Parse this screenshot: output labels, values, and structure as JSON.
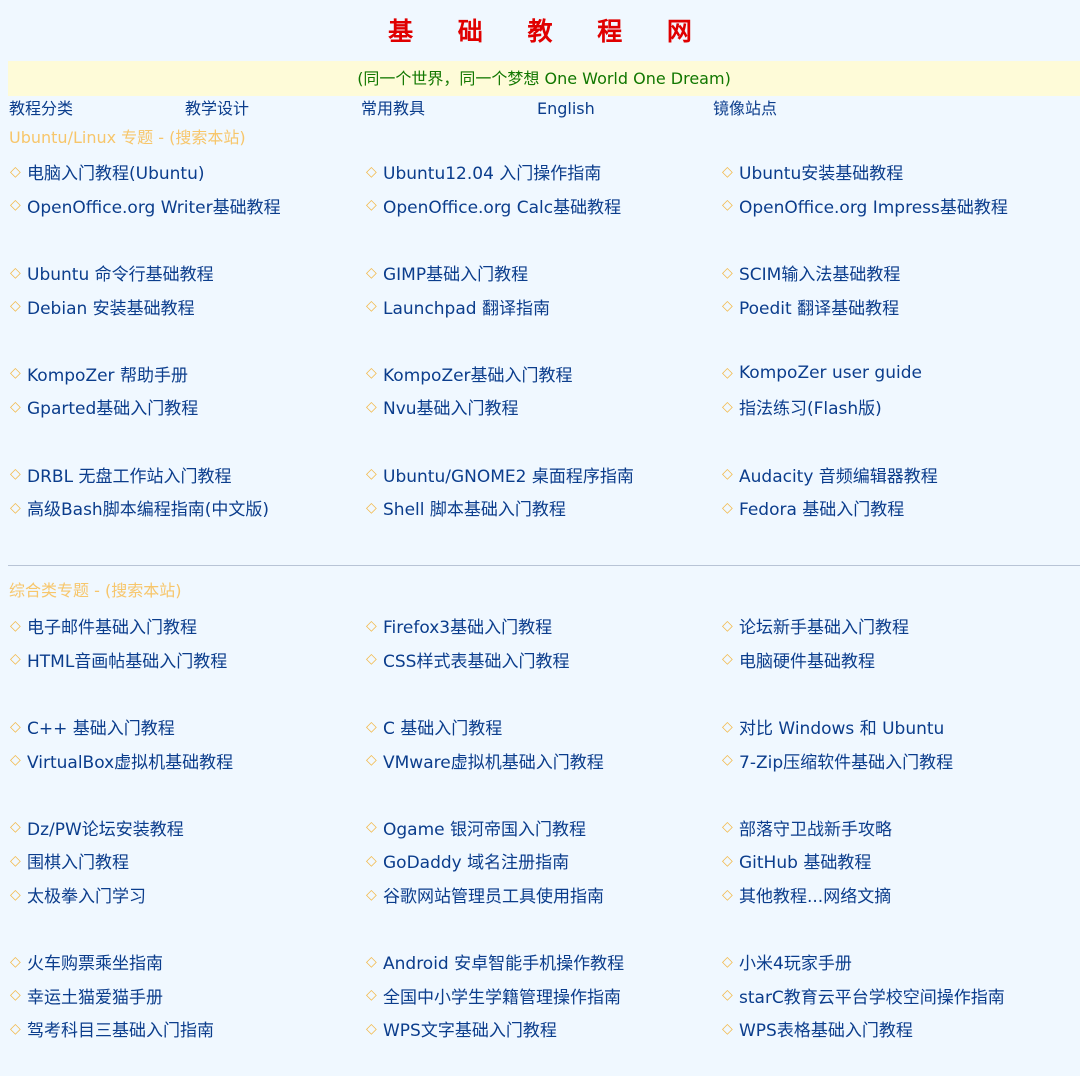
{
  "header": {
    "title": "基 础 教 程 网",
    "slogan": "(同一个世界，同一个梦想 One World One Dream)"
  },
  "nav": [
    "教程分类",
    "教学设计",
    "常用教具",
    "English",
    "镜像站点"
  ],
  "bullet_glyph": "◇",
  "colors": {
    "title": "#e00000",
    "slogan": "#117700",
    "slogan_bg": "#fefbd8",
    "link": "#0b3d8c",
    "section_title": "#f7c66b",
    "bullet": "#f2b94a",
    "page_bg": "#f0f8ff"
  },
  "sections": [
    {
      "title": "Ubuntu/Linux 专题 - (搜索本站)",
      "groups": [
        [
          [
            "电脑入门教程(Ubuntu)",
            "Ubuntu12.04 入门操作指南",
            "Ubuntu安装基础教程"
          ],
          [
            "OpenOffice.org Writer基础教程",
            "OpenOffice.org Calc基础教程",
            "OpenOffice.org Impress基础教程"
          ]
        ],
        [
          [
            "Ubuntu 命令行基础教程",
            "GIMP基础入门教程",
            "SCIM输入法基础教程"
          ],
          [
            "Debian 安装基础教程",
            "Launchpad 翻译指南",
            "Poedit 翻译基础教程"
          ]
        ],
        [
          [
            "KompoZer 帮助手册",
            "KompoZer基础入门教程",
            "KompoZer user guide"
          ],
          [
            "Gparted基础入门教程",
            "Nvu基础入门教程",
            "指法练习(Flash版)"
          ]
        ],
        [
          [
            "DRBL 无盘工作站入门教程",
            "Ubuntu/GNOME2 桌面程序指南",
            "Audacity 音频编辑器教程"
          ],
          [
            "高级Bash脚本编程指南(中文版)",
            "Shell 脚本基础入门教程",
            "Fedora 基础入门教程"
          ]
        ]
      ]
    },
    {
      "title": "综合类专题 - (搜索本站)",
      "groups": [
        [
          [
            "电子邮件基础入门教程",
            "Firefox3基础入门教程",
            "论坛新手基础入门教程"
          ],
          [
            "HTML音画帖基础入门教程",
            "CSS样式表基础入门教程",
            "电脑硬件基础教程"
          ]
        ],
        [
          [
            "C++ 基础入门教程",
            "C 基础入门教程",
            "对比 Windows 和 Ubuntu"
          ],
          [
            "VirtualBox虚拟机基础教程",
            "VMware虚拟机基础入门教程",
            "7-Zip压缩软件基础入门教程"
          ]
        ],
        [
          [
            "Dz/PW论坛安装教程",
            "Ogame 银河帝国入门教程",
            "部落守卫战新手攻略"
          ],
          [
            "围棋入门教程",
            "GoDaddy 域名注册指南",
            "GitHub 基础教程"
          ],
          [
            "太极拳入门学习",
            "谷歌网站管理员工具使用指南",
            "其他教程...网络文摘"
          ]
        ],
        [
          [
            "火车购票乘坐指南",
            "Android 安卓智能手机操作教程",
            "小米4玩家手册"
          ],
          [
            "幸运土猫爱猫手册",
            "全国中小学生学籍管理操作指南",
            "starC教育云平台学校空间操作指南"
          ],
          [
            "驾考科目三基础入门指南",
            "WPS文字基础入门教程",
            "WPS表格基础入门教程"
          ]
        ]
      ]
    }
  ]
}
